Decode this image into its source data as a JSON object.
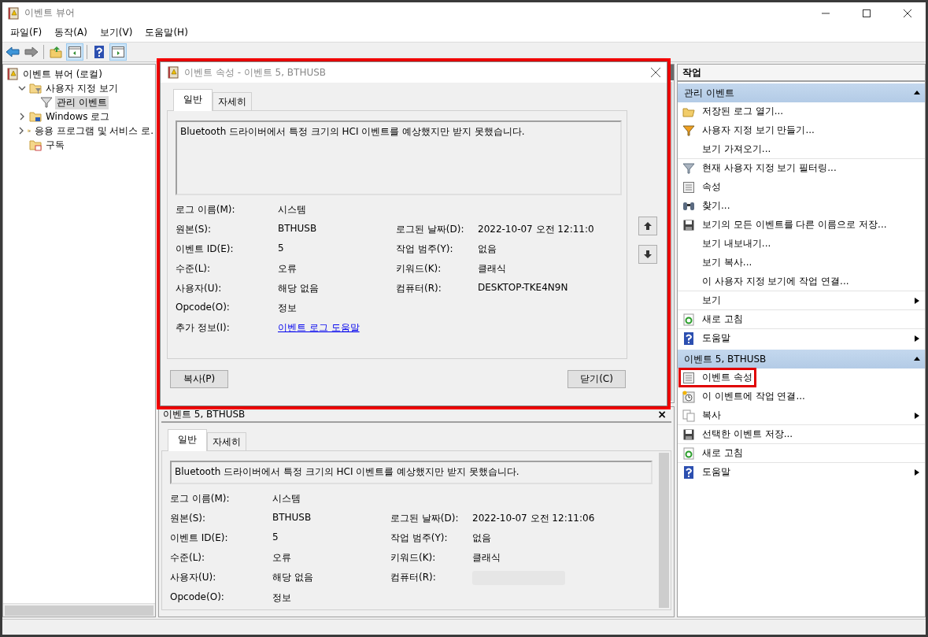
{
  "window": {
    "title": "이벤트 뷰어"
  },
  "menu": [
    "파일(F)",
    "동작(A)",
    "보기(V)",
    "도움말(H)"
  ],
  "tree": [
    {
      "label": "이벤트 뷰어 (로컬)",
      "selected": false,
      "children": [
        {
          "label": "사용자 지정 보기",
          "expanded": true,
          "selected": false,
          "children": [
            {
              "label": "관리 이벤트",
              "selected": true
            }
          ]
        },
        {
          "label": "Windows 로그",
          "expanded": false,
          "selected": false
        },
        {
          "label": "응용 프로그램 및 서비스 로.",
          "expanded": false,
          "selected": false
        },
        {
          "label": "구독",
          "selected": false
        }
      ]
    }
  ],
  "dialog": {
    "title": "이벤트 속성 - 이벤트 5, BTHUSB",
    "highlighted": true,
    "tabs": [
      {
        "label": "일반",
        "selected": true
      },
      {
        "label": "자세히",
        "selected": false
      }
    ],
    "description": "Bluetooth 드라이버에서 특정 크기의 HCI 이벤트를 예상했지만 받지 못했습니다.",
    "rows": [
      {
        "cells": [
          {
            "label": "로그 이름(M):",
            "value": "시스템",
            "kind": "text"
          }
        ]
      },
      {
        "cells": [
          {
            "label": "원본(S):",
            "value": "BTHUSB",
            "kind": "text"
          },
          {
            "label": "로그된 날짜(D):",
            "value": "2022-10-07 오전 12:11:0",
            "kind": "text"
          }
        ]
      },
      {
        "cells": [
          {
            "label": "이벤트 ID(E):",
            "value": "5",
            "kind": "text"
          },
          {
            "label": "작업 범주(Y):",
            "value": "없음",
            "kind": "text"
          }
        ]
      },
      {
        "cells": [
          {
            "label": "수준(L):",
            "value": "오류",
            "kind": "text"
          },
          {
            "label": "키워드(K):",
            "value": "클래식",
            "kind": "text"
          }
        ]
      },
      {
        "cells": [
          {
            "label": "사용자(U):",
            "value": "해당 없음",
            "kind": "text"
          },
          {
            "label": "컴퓨터(R):",
            "value": "DESKTOP-TKE4N9N",
            "kind": "text"
          }
        ]
      },
      {
        "cells": [
          {
            "label": "Opcode(O):",
            "value": "정보",
            "kind": "text"
          }
        ]
      },
      {
        "cells": [
          {
            "label": "추가 정보(I):",
            "value": "이벤트 로그 도움말",
            "kind": "link"
          }
        ]
      }
    ],
    "buttons": [
      "복사(P)",
      "닫기(C)"
    ]
  },
  "preview": {
    "title": "이벤트 5, BTHUSB",
    "close": "×",
    "tabs": [
      {
        "label": "일반",
        "selected": true
      },
      {
        "label": "자세히",
        "selected": false
      }
    ],
    "description": "Bluetooth 드라이버에서 특정 크기의 HCI 이벤트를 예상했지만 받지 못했습니다.",
    "rows": [
      {
        "cells": [
          {
            "label": "로그 이름(M):",
            "value": "시스템",
            "kind": "text"
          }
        ]
      },
      {
        "cells": [
          {
            "label": "원본(S):",
            "value": "BTHUSB",
            "kind": "text"
          },
          {
            "label": "로그된 날짜(D):",
            "value": "2022-10-07 오전 12:11:06",
            "kind": "text"
          }
        ]
      },
      {
        "cells": [
          {
            "label": "이벤트 ID(E):",
            "value": "5",
            "kind": "text"
          },
          {
            "label": "작업 범주(Y):",
            "value": "없음",
            "kind": "text"
          }
        ]
      },
      {
        "cells": [
          {
            "label": "수준(L):",
            "value": "오류",
            "kind": "text"
          },
          {
            "label": "키워드(K):",
            "value": "클래식",
            "kind": "text"
          }
        ]
      },
      {
        "cells": [
          {
            "label": "사용자(U):",
            "value": "해당 없음",
            "kind": "text"
          },
          {
            "label": "컴퓨터(R):",
            "kind": "redacted"
          }
        ]
      },
      {
        "cells": [
          {
            "label": "Opcode(O):",
            "value": "정보",
            "kind": "text"
          }
        ]
      }
    ]
  },
  "actions": {
    "title": "작업",
    "sections": [
      {
        "title": "관리 이벤트",
        "expanded": true,
        "items": [
          {
            "label": "저장된 로그 열기...",
            "submenu": false,
            "separator": false,
            "highlighted": false
          },
          {
            "label": "사용자 지정 보기 만들기...",
            "submenu": false,
            "separator": false,
            "highlighted": false
          },
          {
            "label": "보기 가져오기...",
            "submenu": false,
            "separator": true,
            "highlighted": false
          },
          {
            "label": "현재 사용자 지정 보기 필터링...",
            "submenu": false,
            "separator": false,
            "highlighted": false
          },
          {
            "label": "속성",
            "submenu": false,
            "separator": false,
            "highlighted": false
          },
          {
            "label": "찾기...",
            "submenu": false,
            "separator": false,
            "highlighted": false
          },
          {
            "label": "보기의 모든 이벤트를 다른 이름으로 저장...",
            "submenu": false,
            "separator": false,
            "highlighted": false
          },
          {
            "label": "보기 내보내기...",
            "submenu": false,
            "separator": false,
            "highlighted": false
          },
          {
            "label": "보기 복사...",
            "submenu": false,
            "separator": false,
            "highlighted": false
          },
          {
            "label": "이 사용자 지정 보기에 작업 연결...",
            "submenu": false,
            "separator": true,
            "highlighted": false
          },
          {
            "label": "보기",
            "submenu": true,
            "separator": true,
            "highlighted": false
          },
          {
            "label": "새로 고침",
            "submenu": false,
            "separator": true,
            "highlighted": false
          },
          {
            "label": "도움말",
            "submenu": true,
            "separator": false,
            "highlighted": false
          }
        ]
      },
      {
        "title": "이벤트 5, BTHUSB",
        "expanded": true,
        "items": [
          {
            "label": "이벤트 속성",
            "submenu": false,
            "separator": false,
            "highlighted": true
          },
          {
            "label": "이 이벤트에 작업 연결...",
            "submenu": false,
            "separator": false,
            "highlighted": false
          },
          {
            "label": "복사",
            "submenu": true,
            "separator": true,
            "highlighted": false
          },
          {
            "label": "선택한 이벤트 저장...",
            "submenu": false,
            "separator": true,
            "highlighted": false
          },
          {
            "label": "새로 고침",
            "submenu": false,
            "separator": true,
            "highlighted": false
          },
          {
            "label": "도움말",
            "submenu": true,
            "separator": false,
            "highlighted": false
          }
        ]
      }
    ]
  }
}
